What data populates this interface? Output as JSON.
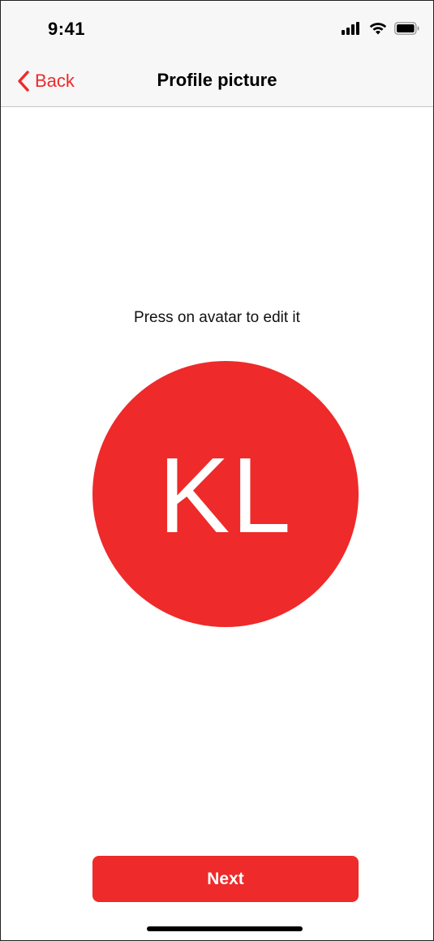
{
  "status_bar": {
    "time": "9:41",
    "icons": [
      "signal-icon",
      "wifi-icon",
      "battery-icon"
    ]
  },
  "nav": {
    "back_label": "Back",
    "back_icon": "chevron-left-icon",
    "title": "Profile picture"
  },
  "main": {
    "hint": "Press on avatar to edit it",
    "avatar_initials": "KL"
  },
  "footer": {
    "next_label": "Next"
  },
  "colors": {
    "accent": "#ee2a2a",
    "header_bg": "#f7f7f7",
    "text": "#000000"
  }
}
